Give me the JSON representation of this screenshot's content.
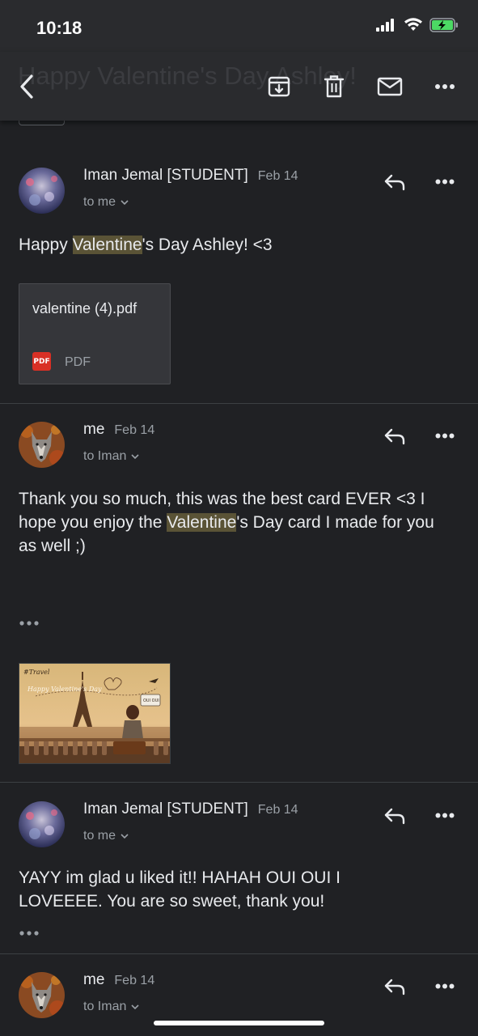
{
  "status_bar": {
    "time": "10:18"
  },
  "app_bar": {
    "subject_ghost": "Happy Valentine's Day Ashley!",
    "icons": [
      "back-arrow-icon",
      "archive-icon",
      "trash-icon",
      "mail-icon",
      "more-options-icon"
    ]
  },
  "messages": [
    {
      "sender": "Iman Jemal [STUDENT]",
      "date": "Feb 14",
      "recipient": "to me",
      "body_before": "Happy ",
      "body_highlight": "Valentine",
      "body_after": "'s Day Ashley! <3",
      "attachment": {
        "name": "valentine (4).pdf",
        "type": "PDF",
        "badge": "PDF"
      }
    },
    {
      "sender": "me",
      "date": "Feb 14",
      "recipient": "to Iman",
      "body_before": "Thank you so much, this was the best card EVER <3 I hope you enjoy the ",
      "body_highlight": "Valentine",
      "body_after": "'s Day card I made for you as well ;)",
      "image": {
        "tag": "#Travel",
        "script": "Happy Valentine's Day",
        "sign": "OUI OUI"
      }
    },
    {
      "sender": "Iman Jemal [STUDENT]",
      "date": "Feb 14",
      "recipient": "to me",
      "body": "YAYY im glad u liked it!! HAHAH OUI OUI I LOVEEEE. You are so sweet, thank you!"
    },
    {
      "sender": "me",
      "date": "Feb 14",
      "recipient": "to Iman"
    }
  ],
  "colors": {
    "background": "#202124",
    "bar": "#2a2b2e",
    "highlight": "#5a5336",
    "text": "#e8eaed",
    "muted": "#9aa0a6",
    "pdf_red": "#d93025"
  }
}
